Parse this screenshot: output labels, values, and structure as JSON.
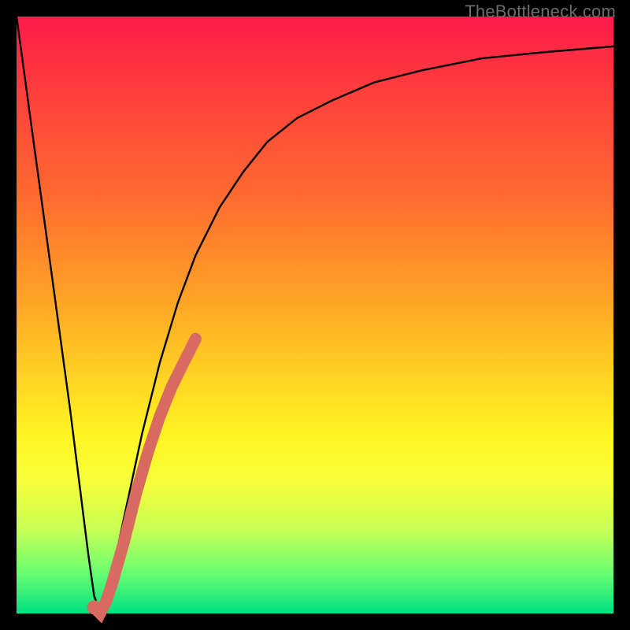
{
  "source_label": "TheBottleneck.com",
  "colors": {
    "frame": "#000000",
    "curve": "#000000",
    "highlight": "#d96a61",
    "gradient_top": "#ff1a4a",
    "gradient_bottom": "#00e082"
  },
  "chart_data": {
    "type": "line",
    "title": "",
    "xlabel": "",
    "ylabel": "",
    "xlim": [
      0,
      100
    ],
    "ylim": [
      0,
      100
    ],
    "grid": false,
    "series": [
      {
        "name": "bottleneck_curve",
        "x": [
          0,
          3,
          6,
          9,
          12,
          13,
          14,
          15,
          18,
          21,
          24,
          27,
          30,
          34,
          38,
          42,
          47,
          53,
          60,
          68,
          78,
          88,
          100
        ],
        "values": [
          100,
          78,
          56,
          34,
          10,
          3,
          0,
          2,
          16,
          30,
          42,
          52,
          60,
          68,
          74,
          79,
          83,
          86,
          89,
          91,
          93,
          94,
          95
        ]
      }
    ],
    "highlight_segment": {
      "description": "thick salmon overlay near the dip on the rising branch",
      "x": [
        13,
        14,
        15,
        16,
        18,
        20,
        22,
        24,
        26,
        28,
        29,
        30
      ],
      "values": [
        1,
        0,
        2,
        5,
        12,
        20,
        27,
        33,
        38,
        42,
        44,
        46
      ]
    }
  }
}
